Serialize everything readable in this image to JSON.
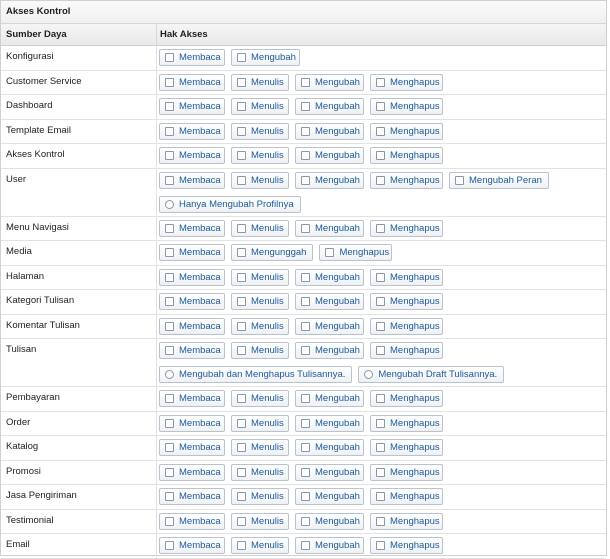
{
  "panel_title": "Akses Kontrol",
  "headers": {
    "resource": "Sumber Daya",
    "access": "Hak Akses"
  },
  "rows": [
    {
      "name": "Konfigurasi",
      "lines": [
        [
          {
            "t": "cb",
            "label": "Membaca"
          },
          {
            "t": "cb",
            "label": "Mengubah"
          }
        ]
      ]
    },
    {
      "name": "Customer Service",
      "lines": [
        [
          {
            "t": "cb",
            "label": "Membaca"
          },
          {
            "t": "cb",
            "label": "Menulis"
          },
          {
            "t": "cb",
            "label": "Mengubah"
          },
          {
            "t": "cb",
            "label": "Menghapus"
          }
        ]
      ]
    },
    {
      "name": "Dashboard",
      "lines": [
        [
          {
            "t": "cb",
            "label": "Membaca"
          },
          {
            "t": "cb",
            "label": "Menulis"
          },
          {
            "t": "cb",
            "label": "Mengubah"
          },
          {
            "t": "cb",
            "label": "Menghapus"
          }
        ]
      ]
    },
    {
      "name": "Template Email",
      "lines": [
        [
          {
            "t": "cb",
            "label": "Membaca"
          },
          {
            "t": "cb",
            "label": "Menulis"
          },
          {
            "t": "cb",
            "label": "Mengubah"
          },
          {
            "t": "cb",
            "label": "Menghapus"
          }
        ]
      ]
    },
    {
      "name": "Akses Kontrol",
      "lines": [
        [
          {
            "t": "cb",
            "label": "Membaca"
          },
          {
            "t": "cb",
            "label": "Menulis"
          },
          {
            "t": "cb",
            "label": "Mengubah"
          },
          {
            "t": "cb",
            "label": "Menghapus"
          }
        ]
      ]
    },
    {
      "name": "User",
      "lines": [
        [
          {
            "t": "cb",
            "label": "Membaca"
          },
          {
            "t": "cb",
            "label": "Menulis"
          },
          {
            "t": "cb",
            "label": "Mengubah"
          },
          {
            "t": "cb",
            "label": "Menghapus"
          },
          {
            "t": "cb",
            "label": "Mengubah Peran"
          }
        ],
        [
          {
            "t": "rb",
            "label": "Hanya Mengubah Profilnya"
          }
        ]
      ]
    },
    {
      "name": "Menu Navigasi",
      "lines": [
        [
          {
            "t": "cb",
            "label": "Membaca"
          },
          {
            "t": "cb",
            "label": "Menulis"
          },
          {
            "t": "cb",
            "label": "Mengubah"
          },
          {
            "t": "cb",
            "label": "Menghapus"
          }
        ]
      ]
    },
    {
      "name": "Media",
      "lines": [
        [
          {
            "t": "cb",
            "label": "Membaca"
          },
          {
            "t": "cb",
            "label": "Mengunggah"
          },
          {
            "t": "cb",
            "label": "Menghapus"
          }
        ]
      ]
    },
    {
      "name": "Halaman",
      "lines": [
        [
          {
            "t": "cb",
            "label": "Membaca"
          },
          {
            "t": "cb",
            "label": "Menulis"
          },
          {
            "t": "cb",
            "label": "Mengubah"
          },
          {
            "t": "cb",
            "label": "Menghapus"
          }
        ]
      ]
    },
    {
      "name": "Kategori Tulisan",
      "lines": [
        [
          {
            "t": "cb",
            "label": "Membaca"
          },
          {
            "t": "cb",
            "label": "Menulis"
          },
          {
            "t": "cb",
            "label": "Mengubah"
          },
          {
            "t": "cb",
            "label": "Menghapus"
          }
        ]
      ]
    },
    {
      "name": "Komentar Tulisan",
      "lines": [
        [
          {
            "t": "cb",
            "label": "Membaca"
          },
          {
            "t": "cb",
            "label": "Menulis"
          },
          {
            "t": "cb",
            "label": "Mengubah"
          },
          {
            "t": "cb",
            "label": "Menghapus"
          }
        ]
      ]
    },
    {
      "name": "Tulisan",
      "lines": [
        [
          {
            "t": "cb",
            "label": "Membaca"
          },
          {
            "t": "cb",
            "label": "Menulis"
          },
          {
            "t": "cb",
            "label": "Mengubah"
          },
          {
            "t": "cb",
            "label": "Menghapus"
          }
        ],
        [
          {
            "t": "rb",
            "label": "Mengubah dan Menghapus Tulisannya."
          },
          {
            "t": "rb",
            "label": "Mengubah Draft Tulisannya."
          }
        ]
      ]
    },
    {
      "name": "Pembayaran",
      "lines": [
        [
          {
            "t": "cb",
            "label": "Membaca"
          },
          {
            "t": "cb",
            "label": "Menulis"
          },
          {
            "t": "cb",
            "label": "Mengubah"
          },
          {
            "t": "cb",
            "label": "Menghapus"
          }
        ]
      ]
    },
    {
      "name": "Order",
      "lines": [
        [
          {
            "t": "cb",
            "label": "Membaca"
          },
          {
            "t": "cb",
            "label": "Menulis"
          },
          {
            "t": "cb",
            "label": "Mengubah"
          },
          {
            "t": "cb",
            "label": "Menghapus"
          }
        ]
      ]
    },
    {
      "name": "Katalog",
      "lines": [
        [
          {
            "t": "cb",
            "label": "Membaca"
          },
          {
            "t": "cb",
            "label": "Menulis"
          },
          {
            "t": "cb",
            "label": "Mengubah"
          },
          {
            "t": "cb",
            "label": "Menghapus"
          }
        ]
      ]
    },
    {
      "name": "Promosi",
      "lines": [
        [
          {
            "t": "cb",
            "label": "Membaca"
          },
          {
            "t": "cb",
            "label": "Menulis"
          },
          {
            "t": "cb",
            "label": "Mengubah"
          },
          {
            "t": "cb",
            "label": "Menghapus"
          }
        ]
      ]
    },
    {
      "name": "Jasa Pengiriman",
      "lines": [
        [
          {
            "t": "cb",
            "label": "Membaca"
          },
          {
            "t": "cb",
            "label": "Menulis"
          },
          {
            "t": "cb",
            "label": "Mengubah"
          },
          {
            "t": "cb",
            "label": "Menghapus"
          }
        ]
      ]
    },
    {
      "name": "Testimonial",
      "lines": [
        [
          {
            "t": "cb",
            "label": "Membaca"
          },
          {
            "t": "cb",
            "label": "Menulis"
          },
          {
            "t": "cb",
            "label": "Mengubah"
          },
          {
            "t": "cb",
            "label": "Menghapus"
          }
        ]
      ]
    },
    {
      "name": "Email",
      "lines": [
        [
          {
            "t": "cb",
            "label": "Membaca"
          },
          {
            "t": "cb",
            "label": "Menulis"
          },
          {
            "t": "cb",
            "label": "Mengubah"
          },
          {
            "t": "cb",
            "label": "Menghapus"
          }
        ]
      ]
    }
  ]
}
